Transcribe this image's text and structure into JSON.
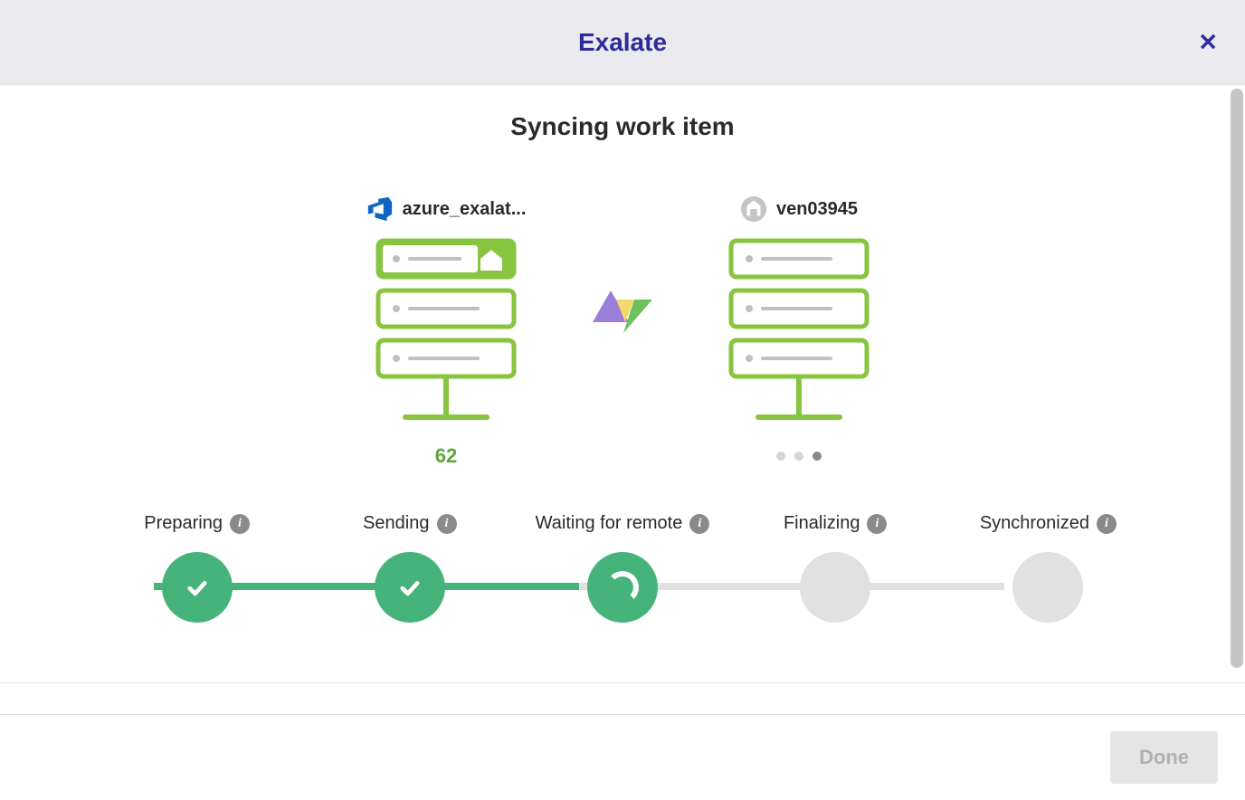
{
  "header": {
    "title": "Exalate"
  },
  "main": {
    "title": "Syncing work item",
    "source": {
      "name": "azure_exalat...",
      "id": "62"
    },
    "target": {
      "name": "ven03945"
    },
    "steps": [
      {
        "label": "Preparing",
        "status": "done"
      },
      {
        "label": "Sending",
        "status": "done"
      },
      {
        "label": "Waiting for remote",
        "status": "active"
      },
      {
        "label": "Finalizing",
        "status": "pending"
      },
      {
        "label": "Synchronized",
        "status": "pending"
      }
    ]
  },
  "footer": {
    "done_label": "Done"
  }
}
